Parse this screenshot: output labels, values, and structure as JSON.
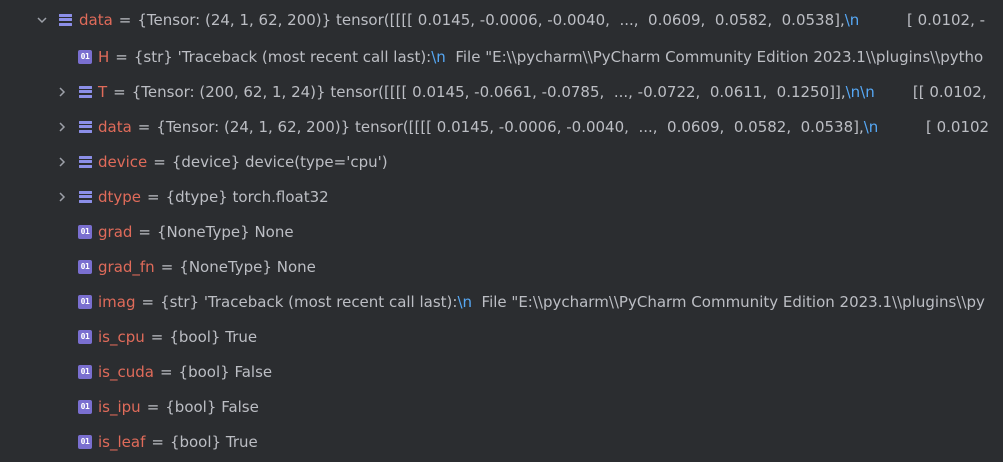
{
  "rows": [
    {
      "name": "data",
      "type": "{Tensor: (24, 1, 62, 200)}",
      "value_parts": [
        "tensor([[[[ 0.0145, -0.0006, -0.0040,  ...,  0.0609,  0.0582,  0.0538],",
        "\\n",
        "          [ 0.0102, -"
      ]
    },
    {
      "name": "H",
      "type": "{str}",
      "value_parts": [
        "'Traceback (most recent call last):",
        "\\n",
        "  File \"E:\\\\pycharm\\\\PyCharm Community Edition 2023.1\\\\plugins\\\\pytho"
      ]
    },
    {
      "name": "T",
      "type": "{Tensor: (200, 62, 1, 24)}",
      "value_parts": [
        "tensor([[[[ 0.0145, -0.0661, -0.0785,  ..., -0.0722,  0.0611,  0.1250]],",
        "\\n\\n",
        "        [[ 0.0102, "
      ]
    },
    {
      "name": "data",
      "type": "{Tensor: (24, 1, 62, 200)}",
      "value_parts": [
        "tensor([[[[ 0.0145, -0.0006, -0.0040,  ...,  0.0609,  0.0582,  0.0538],",
        "\\n",
        "          [ 0.0102"
      ]
    },
    {
      "name": "device",
      "type": "{device}",
      "value_parts": [
        "device(type='cpu')"
      ]
    },
    {
      "name": "dtype",
      "type": "{dtype}",
      "value_parts": [
        "torch.float32"
      ]
    },
    {
      "name": "grad",
      "type": "{NoneType}",
      "value_parts": [
        "None"
      ]
    },
    {
      "name": "grad_fn",
      "type": "{NoneType}",
      "value_parts": [
        "None"
      ]
    },
    {
      "name": "imag",
      "type": "{str}",
      "value_parts": [
        "'Traceback (most recent call last):",
        "\\n",
        "  File \"E:\\\\pycharm\\\\PyCharm Community Edition 2023.1\\\\plugins\\\\py"
      ]
    },
    {
      "name": "is_cpu",
      "type": "{bool}",
      "value_parts": [
        "True"
      ]
    },
    {
      "name": "is_cuda",
      "type": "{bool}",
      "value_parts": [
        "False"
      ]
    },
    {
      "name": "is_ipu",
      "type": "{bool}",
      "value_parts": [
        "False"
      ]
    },
    {
      "name": "is_leaf",
      "type": "{bool}",
      "value_parts": [
        "True"
      ]
    }
  ],
  "icons": {
    "expanded": "chevron-down-icon",
    "collapsed": "chevron-right-icon",
    "field": "field-icon",
    "primitive": "primitive-value-icon",
    "primitive_glyph": "01"
  },
  "colors": {
    "background": "#2b2d30",
    "name": "#e06b5a",
    "text": "#bcbec4",
    "escape": "#56a8f5",
    "icon": "#8c8fe8"
  }
}
